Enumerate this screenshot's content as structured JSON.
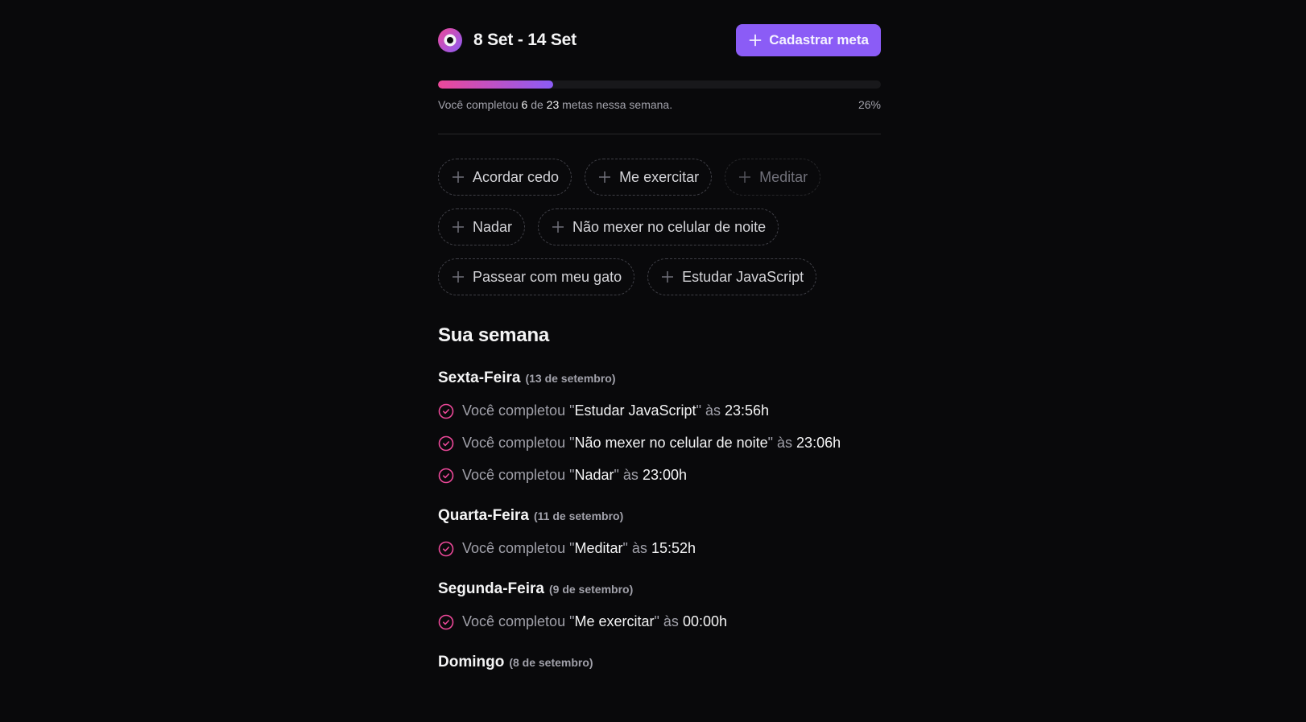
{
  "header": {
    "week_label": "8 Set - 14 Set",
    "create_goal_label": "Cadastrar meta"
  },
  "progress": {
    "fraction": 0.26,
    "prefix": "Você completou",
    "completed": "6",
    "of_word": "de",
    "total": "23",
    "suffix": "metas nessa semana.",
    "percent_label": "26%"
  },
  "pending_goals": [
    {
      "label": "Acordar cedo",
      "disabled": false
    },
    {
      "label": "Me exercitar",
      "disabled": false
    },
    {
      "label": "Meditar",
      "disabled": true
    },
    {
      "label": "Nadar",
      "disabled": false
    },
    {
      "label": "Não mexer no celular de noite",
      "disabled": false
    },
    {
      "label": "Passear com meu gato",
      "disabled": false
    },
    {
      "label": "Estudar JavaScript",
      "disabled": false
    }
  ],
  "week": {
    "title": "Sua semana",
    "completed_prefix": "Você completou",
    "time_prefix": "às",
    "days": [
      {
        "name": "Sexta-Feira",
        "date": "(13 de setembro)",
        "entries": [
          {
            "goal": "Estudar JavaScript",
            "time": "23:56h"
          },
          {
            "goal": "Não mexer no celular de noite",
            "time": "23:06h"
          },
          {
            "goal": "Nadar",
            "time": "23:00h"
          }
        ]
      },
      {
        "name": "Quarta-Feira",
        "date": "(11 de setembro)",
        "entries": [
          {
            "goal": "Meditar",
            "time": "15:52h"
          }
        ]
      },
      {
        "name": "Segunda-Feira",
        "date": "(9 de setembro)",
        "entries": [
          {
            "goal": "Me exercitar",
            "time": "00:00h"
          }
        ]
      },
      {
        "name": "Domingo",
        "date": "(8 de setembro)",
        "entries": []
      }
    ]
  },
  "colors": {
    "accent": "#8b5cf6",
    "pink": "#ec4899",
    "background": "#09090b"
  },
  "icons": {
    "logo": "in-orbit-logo-icon",
    "add": "plus-icon",
    "completed": "circle-check-icon"
  }
}
